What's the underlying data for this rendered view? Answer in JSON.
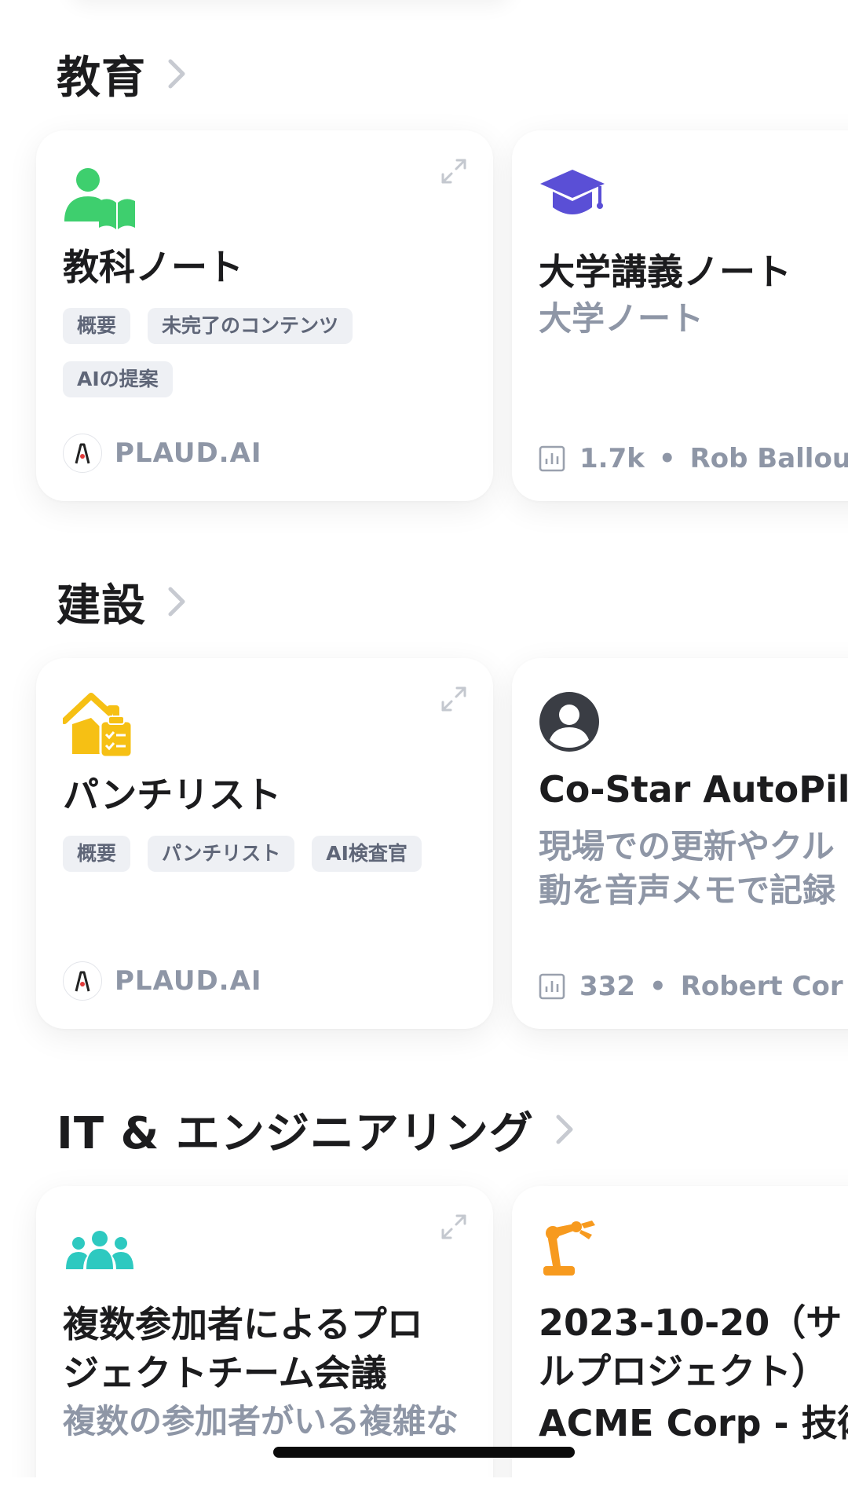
{
  "sections": [
    {
      "title": "教育",
      "cards": [
        {
          "title": "教科ノート",
          "tags": [
            "概要",
            "未完了のコンテンツ",
            "AIの提案"
          ],
          "author": "PLAUD.AI",
          "icon": "person-book-icon",
          "icon_color": "#3ecf6e"
        },
        {
          "title": "大学講義ノート",
          "subtitle": "大学ノート",
          "stats_count": "1.7k",
          "stats_separator": "•",
          "author": "Rob Ballou",
          "icon": "graduation-cap-icon",
          "icon_color": "#5a4fd6"
        }
      ]
    },
    {
      "title": "建設",
      "cards": [
        {
          "title": "パンチリスト",
          "tags": [
            "概要",
            "パンチリスト",
            "AI検査官"
          ],
          "author": "PLAUD.AI",
          "icon": "house-clipboard-icon",
          "icon_color": "#f6c014"
        },
        {
          "title": "Co-Star AutoPil",
          "subtitle_lines": [
            "現場での更新やクル",
            "動を音声メモで記録"
          ],
          "stats_count": "332",
          "stats_separator": "•",
          "author": "Robert Cor",
          "icon": "user-circle-icon",
          "icon_color": "#3a3d44"
        }
      ]
    },
    {
      "title": "IT & エンジニアリング",
      "cards": [
        {
          "title_lines": [
            "複数参加者によるプロ",
            "ジェクトチーム会議"
          ],
          "subtitle": "複数の参加者がいる複雑な",
          "icon": "users-group-icon",
          "icon_color": "#2ec9c0"
        },
        {
          "title_lines": [
            "2023-10-20（サ",
            "ルプロジェクト）",
            "ACME Corp - 技術"
          ],
          "icon": "robot-arm-icon",
          "icon_color": "#f79a1e"
        }
      ]
    }
  ]
}
